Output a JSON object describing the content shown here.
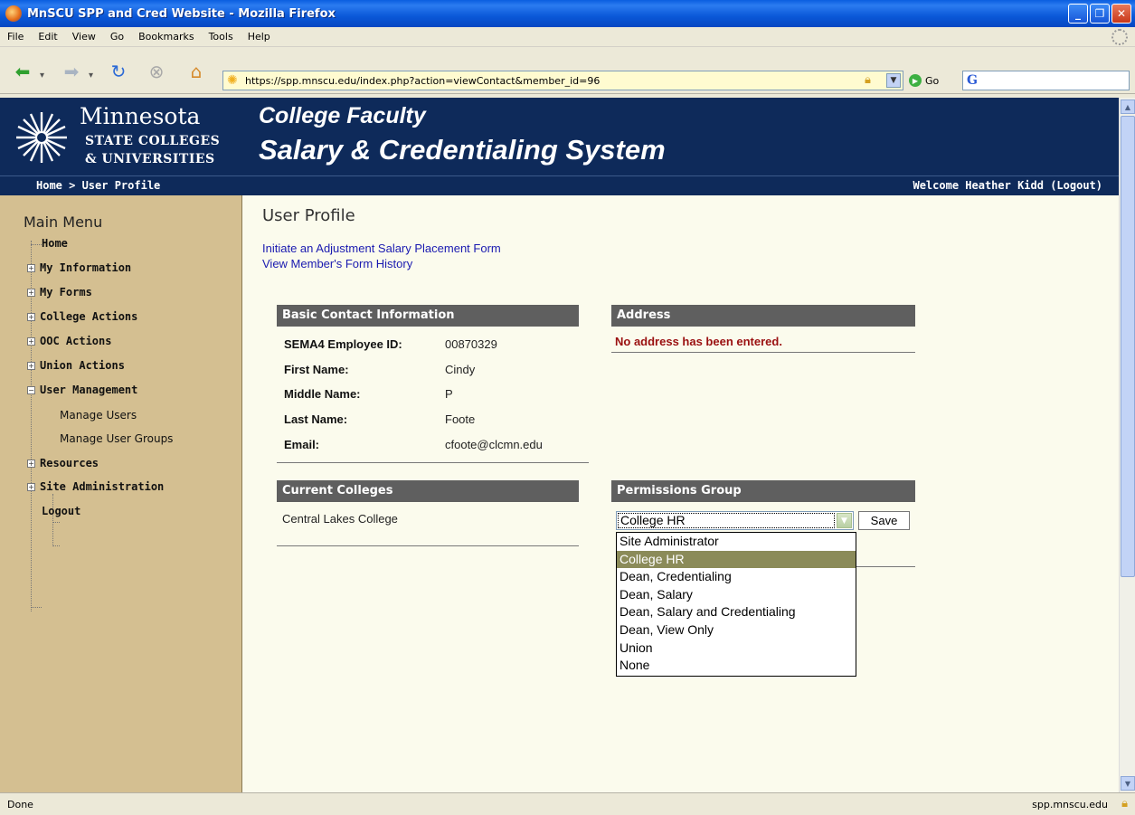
{
  "window": {
    "title": "MnSCU SPP and Cred Website - Mozilla Firefox"
  },
  "menubar": [
    "File",
    "Edit",
    "View",
    "Go",
    "Bookmarks",
    "Tools",
    "Help"
  ],
  "navbar": {
    "url": "https://spp.mnscu.edu/index.php?action=viewContact&member_id=96",
    "go_label": "Go",
    "search_icon": "G"
  },
  "banner": {
    "logo_line1": "Minnesota",
    "logo_line2": "STATE COLLEGES",
    "logo_line3": "& UNIVERSITIES",
    "system_title1": "College Faculty",
    "system_title2": "Salary & Credentialing System"
  },
  "crumbbar": {
    "breadcrumb": "Home > User Profile",
    "welcome": "Welcome Heather Kidd (Logout)"
  },
  "sidebar": {
    "title": "Main Menu",
    "items": [
      "Home",
      "My Information",
      "My Forms",
      "College Actions",
      "OOC Actions",
      "Union Actions",
      "User Management",
      "Resources",
      "Site Administration",
      "Logout"
    ],
    "sub_items": [
      "Manage Users",
      "Manage User Groups"
    ]
  },
  "content": {
    "page_title": "User Profile",
    "link1": "Initiate an Adjustment Salary Placement Form",
    "link2": "View Member's Form History",
    "basic_contact": {
      "heading": "Basic Contact Information",
      "labels": [
        "SEMA4 Employee ID:",
        "First Name:",
        "Middle Name:",
        "Last Name:",
        "Email:"
      ],
      "values": [
        "00870329",
        "Cindy",
        "P",
        "Foote",
        "cfoote@clcmn.edu"
      ]
    },
    "address": {
      "heading": "Address",
      "message": "No address has been entered."
    },
    "colleges": {
      "heading": "Current Colleges",
      "items": [
        "Central Lakes College"
      ]
    },
    "permissions": {
      "heading": "Permissions Group",
      "selected": "College HR",
      "save_label": "Save",
      "options": [
        "Site Administrator",
        "College HR",
        "Dean, Credentialing",
        "Dean, Salary",
        "Dean, Salary and Credentialing",
        "Dean, View Only",
        "Union",
        "None"
      ]
    }
  },
  "statusbar": {
    "status": "Done",
    "domain": "spp.mnscu.edu"
  }
}
